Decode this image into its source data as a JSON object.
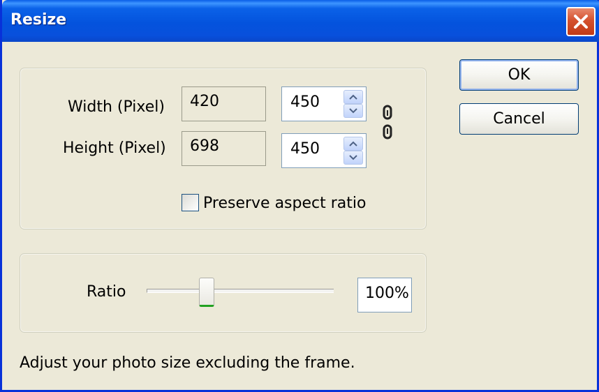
{
  "window": {
    "title": "Resize"
  },
  "size": {
    "width_label": "Width (Pixel)",
    "height_label": "Height (Pixel)",
    "original_width": "420",
    "original_height": "698",
    "new_width": "450",
    "new_height": "450",
    "preserve_label": "Preserve aspect ratio",
    "preserve_checked": false
  },
  "ratio": {
    "label": "Ratio",
    "value": "100%"
  },
  "buttons": {
    "ok": "OK",
    "cancel": "Cancel"
  },
  "hint": "Adjust your photo size excluding the frame.",
  "colors": {
    "titlebar": "#0453dd",
    "dialog_bg": "#ece9d8",
    "close": "#c23a16"
  },
  "icons": {
    "close": "close-icon",
    "link": "chain-link-icon",
    "spin_up": "arrow-up-icon",
    "spin_down": "arrow-down-icon"
  }
}
